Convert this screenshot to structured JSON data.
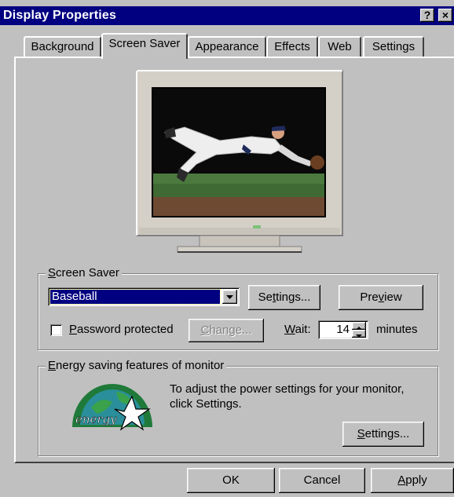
{
  "window": {
    "title": "Display Properties",
    "help_btn": "?",
    "close_btn": "×"
  },
  "tabs": [
    {
      "label": "Background",
      "active": false
    },
    {
      "label": "Screen Saver",
      "active": true
    },
    {
      "label": "Appearance",
      "active": false
    },
    {
      "label": "Effects",
      "active": false
    },
    {
      "label": "Web",
      "active": false
    },
    {
      "label": "Settings",
      "active": false
    }
  ],
  "preview": {
    "scene": "baseball-player-diving-catch"
  },
  "screensaver": {
    "legend_u": "S",
    "legend_rest": "creen Saver",
    "selected": "Baseball",
    "settings_pre": "Se",
    "settings_u": "t",
    "settings_post": "tings...",
    "preview_pre": "Pre",
    "preview_u": "v",
    "preview_post": "iew",
    "password_u": "P",
    "password_rest": "assword protected",
    "password_checked": false,
    "change_u": "C",
    "change_rest": "hange...",
    "wait_u": "W",
    "wait_rest": "ait:",
    "wait_value": "14",
    "minutes": "minutes"
  },
  "energy": {
    "legend_u": "E",
    "legend_rest": "nergy saving features of monitor",
    "line1": "To adjust the power settings for your monitor,",
    "line2": "click Settings.",
    "settings_u": "S",
    "settings_rest": "ettings...",
    "logo_text": "energy"
  },
  "footer": {
    "ok": "OK",
    "cancel": "Cancel",
    "apply_u": "A",
    "apply_rest": "pply"
  },
  "colors": {
    "titlebar": "#000080",
    "face": "#c0c0c0",
    "selection": "#000080"
  }
}
